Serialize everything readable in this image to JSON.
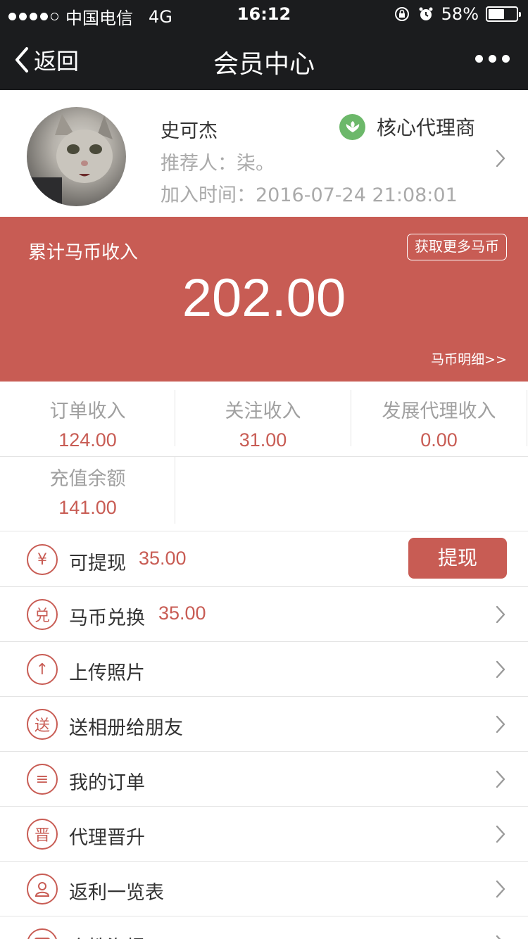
{
  "status_bar": {
    "carrier": "中国电信",
    "network": "4G",
    "time": "16:12",
    "battery": "58%",
    "battery_level": 0.58,
    "icons": [
      "signal-dots-icon",
      "orientation-lock-icon",
      "alarm-icon",
      "battery-icon"
    ]
  },
  "nav": {
    "back_label": "返回",
    "title": "会员中心",
    "more_icon": "more-dots-icon"
  },
  "profile": {
    "name": "史可杰",
    "referrer": "推荐人：柒。",
    "join_time": "加入时间：2016-07-24 21:08:01",
    "level": "核心代理商",
    "level_color": "#6cb86a"
  },
  "coins": {
    "title": "累计马币收入",
    "get_more": "获取更多马币",
    "amount": "202.00",
    "detail_link": "马币明细>>",
    "bg_color": "#c85c54"
  },
  "stats": [
    {
      "label": "订单收入",
      "value": "124.00"
    },
    {
      "label": "关注收入",
      "value": "31.00"
    },
    {
      "label": "发展代理收入",
      "value": "0.00"
    },
    {
      "label": "充值余额",
      "value": "141.00"
    }
  ],
  "menu": {
    "withdraw": {
      "icon_char": "¥",
      "label": "可提现",
      "amount": "35.00",
      "button": "提现"
    },
    "exchange": {
      "icon_char": "兑",
      "label": "马币兑换",
      "amount": "35.00"
    },
    "upload": {
      "icon_char": "↑",
      "label": "上传照片"
    },
    "send_album": {
      "icon_char": "送",
      "label": "送相册给朋友"
    },
    "orders": {
      "icon_char": "≡",
      "label": "我的订单"
    },
    "promotion": {
      "icon_char": "晋",
      "label": "代理晋升"
    },
    "rebate": {
      "icon_char": "人",
      "label": "返利一览表"
    },
    "poster": {
      "label": "个性海报"
    }
  },
  "accent_color": "#c85c54"
}
